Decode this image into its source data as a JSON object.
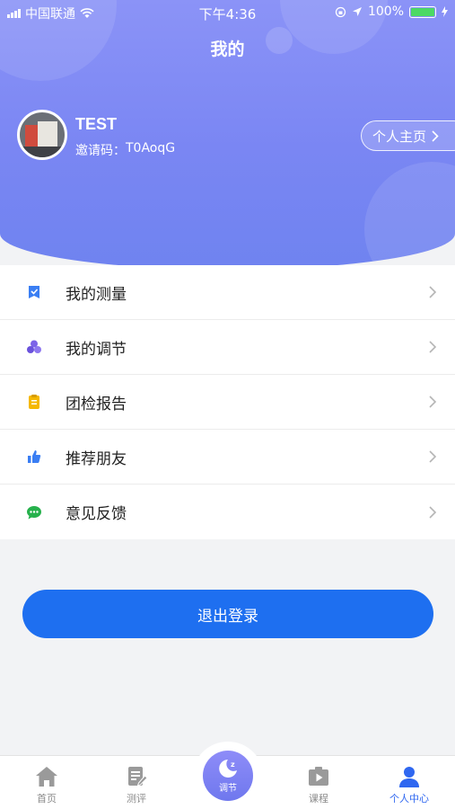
{
  "status_bar": {
    "carrier": "中国联通",
    "time": "下午4:36",
    "battery": "100%"
  },
  "header": {
    "title": "我的"
  },
  "profile": {
    "username": "TEST",
    "invite_label": "邀请码：",
    "invite_code": "T0AoqG",
    "home_button": "个人主页"
  },
  "menu": {
    "items": [
      {
        "label": "我的测量",
        "icon": "measure-icon",
        "color": "#3a7ef3"
      },
      {
        "label": "我的调节",
        "icon": "adjust-icon",
        "color": "#7c63e8"
      },
      {
        "label": "团检报告",
        "icon": "report-icon",
        "color": "#f5b800"
      },
      {
        "label": "推荐朋友",
        "icon": "thumbs-up-icon",
        "color": "#3a7ef3"
      },
      {
        "label": "意见反馈",
        "icon": "feedback-icon",
        "color": "#26b14c"
      }
    ]
  },
  "logout": {
    "label": "退出登录"
  },
  "tabbar": {
    "tabs": [
      {
        "label": "首页",
        "icon": "home-icon"
      },
      {
        "label": "测评",
        "icon": "assessment-icon"
      },
      {
        "label": "调节",
        "icon": "moon-sleep-icon"
      },
      {
        "label": "课程",
        "icon": "course-icon"
      },
      {
        "label": "个人中心",
        "icon": "person-icon"
      }
    ],
    "active_index": 4
  },
  "colors": {
    "primary": "#1e6ff0",
    "header_gradient_top": "#8b93f7",
    "header_gradient_bottom": "#6f83f0",
    "tab_active": "#2f67f0"
  }
}
